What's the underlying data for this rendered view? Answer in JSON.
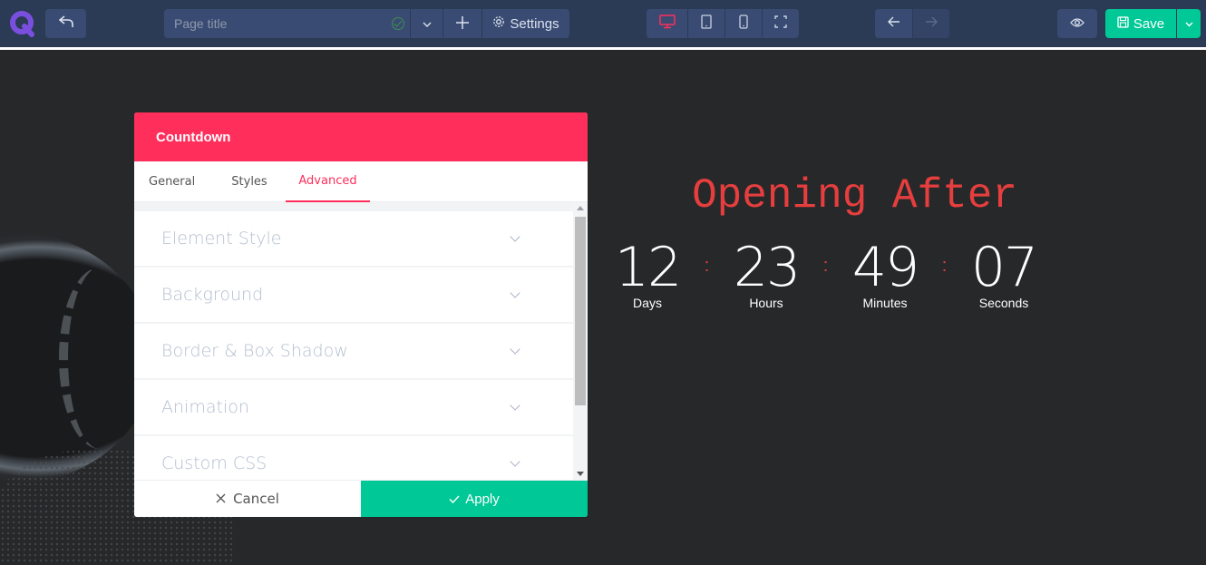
{
  "toolbar": {
    "page_title_placeholder": "Page title",
    "page_title_value": "",
    "settings_label": "Settings",
    "save_label": "Save",
    "active_device": "desktop",
    "devices": [
      "desktop",
      "tablet",
      "mobile",
      "fullscreen"
    ],
    "colors": {
      "accent": "#ff2e5b",
      "save": "#00c896",
      "bar": "#2b3a55",
      "button": "#394b72"
    }
  },
  "modal": {
    "title": "Countdown",
    "tabs": [
      {
        "label": "General",
        "active": false
      },
      {
        "label": "Styles",
        "active": false
      },
      {
        "label": "Advanced",
        "active": true
      }
    ],
    "sections": [
      {
        "label": "Element Style"
      },
      {
        "label": "Background"
      },
      {
        "label": "Border & Box Shadow"
      },
      {
        "label": "Animation"
      },
      {
        "label": "Custom CSS"
      }
    ],
    "cancel_label": "Cancel",
    "apply_label": "Apply"
  },
  "countdown": {
    "title": "Opening After",
    "separator": ":",
    "units": [
      {
        "value": "12",
        "label": "Days"
      },
      {
        "value": "23",
        "label": "Hours"
      },
      {
        "value": "49",
        "label": "Minutes"
      },
      {
        "value": "07",
        "label": "Seconds"
      }
    ],
    "title_color": "#e63e3e"
  }
}
